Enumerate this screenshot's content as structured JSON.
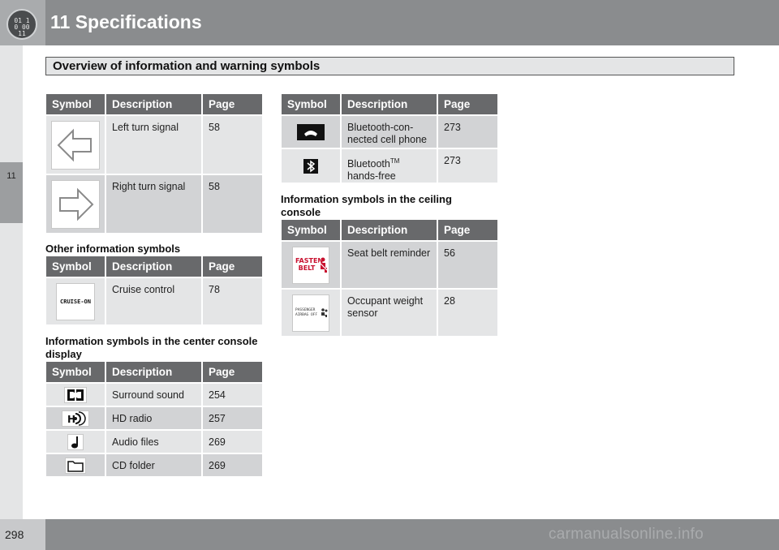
{
  "header": {
    "chapter_icon_text": "01 10 00 11",
    "chapter_title": "11 Specifications"
  },
  "side_tab": {
    "label": "11"
  },
  "section": {
    "title": "Overview of information and warning symbols"
  },
  "columns": {
    "symbol": "Symbol",
    "description": "Description",
    "page": "Page"
  },
  "turn_signals": [
    {
      "description": "Left turn signal",
      "page": "58"
    },
    {
      "description": "Right turn signal",
      "page": "58"
    }
  ],
  "other_symbols": {
    "heading": "Other information symbols",
    "rows": [
      {
        "symbol_text": "CRUISE-ON",
        "description": "Cruise control",
        "page": "78"
      }
    ]
  },
  "center_console": {
    "heading": "Information symbols in the center console display",
    "rows": [
      {
        "description": "Surround sound",
        "page": "254"
      },
      {
        "description": "HD radio",
        "page": "257"
      },
      {
        "description": "Audio files",
        "page": "269"
      },
      {
        "description": "CD folder",
        "page": "269"
      }
    ]
  },
  "bluetooth": {
    "rows": [
      {
        "description": "Bluetooth-con-nected cell phone",
        "page": "273"
      },
      {
        "description_main": "Bluetooth",
        "description_sup": "TM",
        "description_tail": "hands-free",
        "page": "273"
      }
    ]
  },
  "ceiling_console": {
    "heading": "Information symbols in the ceiling console",
    "rows": [
      {
        "symbol_line1": "FASTEN",
        "symbol_line2": "BELT",
        "description": "Seat belt reminder",
        "page": "56"
      },
      {
        "symbol_line1": "PASSENGER",
        "symbol_line2": "AIRBAG OFF",
        "description": "Occupant weight sensor",
        "page": "28"
      }
    ]
  },
  "footer": {
    "page_number": "298",
    "watermark": "carmanualsonline.info"
  },
  "icons": {
    "left_turn": "left-arrow-icon",
    "right_turn": "right-arrow-icon",
    "surround": "dolby-surround-icon",
    "hd_radio": "hd-radio-icon",
    "audio_files": "music-note-icon",
    "cd_folder": "folder-icon",
    "phone": "phone-handset-icon",
    "bluetooth": "bluetooth-icon",
    "seat_belt": "seat-belt-icon",
    "airbag": "airbag-icon"
  }
}
